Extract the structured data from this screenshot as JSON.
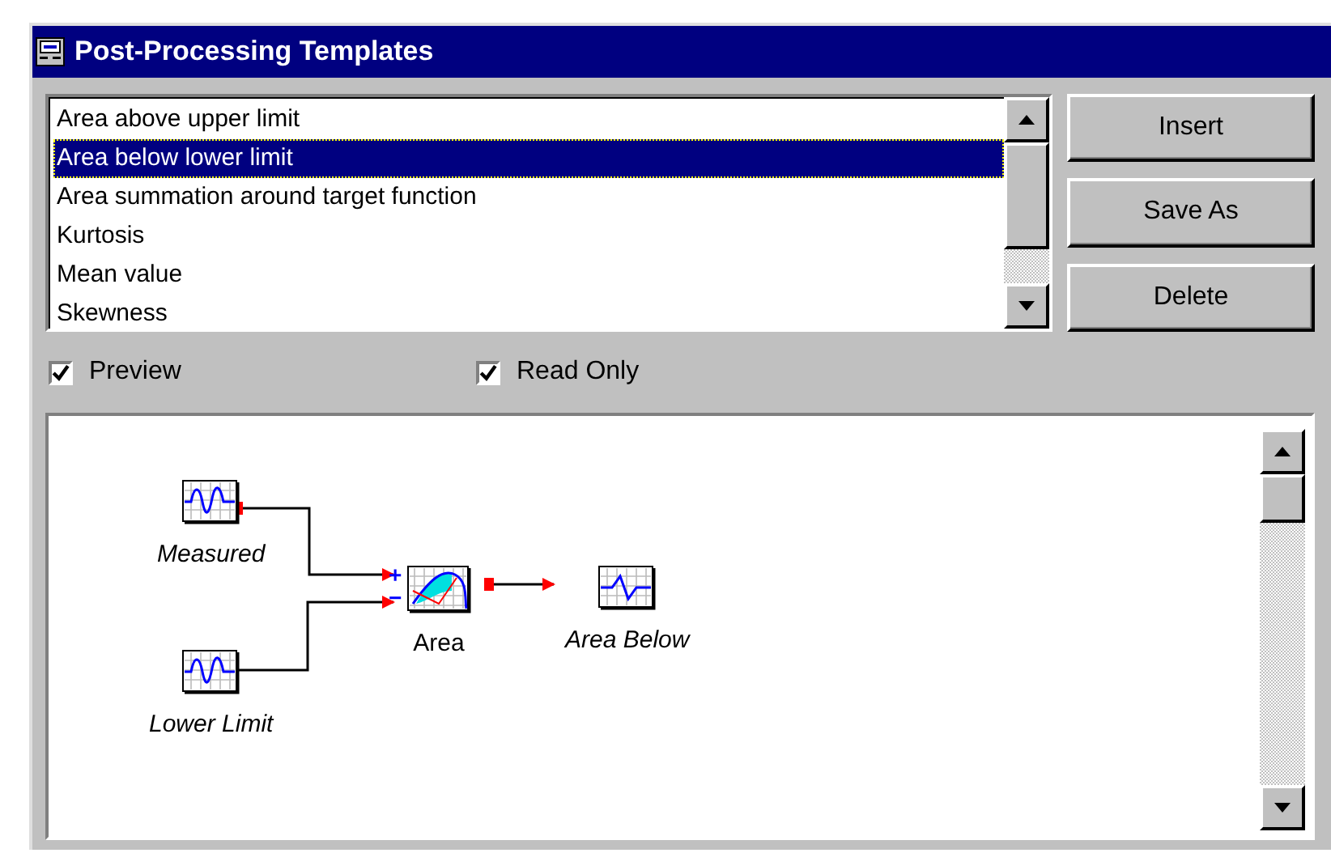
{
  "window": {
    "title": "Post-Processing Templates"
  },
  "templates": [
    {
      "label": "Area above upper limit",
      "selected": false
    },
    {
      "label": "Area below lower limit",
      "selected": true
    },
    {
      "label": "Area summation around target function",
      "selected": false
    },
    {
      "label": "Kurtosis",
      "selected": false
    },
    {
      "label": "Mean value",
      "selected": false
    },
    {
      "label": "Skewness",
      "selected": false
    }
  ],
  "buttons": [
    "Insert",
    "Save As",
    "Delete"
  ],
  "options": [
    {
      "label": "Preview",
      "checked": true
    },
    {
      "label": "Read Only",
      "checked": true
    }
  ],
  "diagram": {
    "nodes": [
      {
        "kind": "source",
        "label": "Measured"
      },
      {
        "kind": "source",
        "label": "Lower Limit"
      },
      {
        "kind": "function",
        "label": "Area",
        "inputs": [
          "+",
          "−"
        ]
      },
      {
        "kind": "output",
        "label": "Area Below"
      }
    ]
  }
}
